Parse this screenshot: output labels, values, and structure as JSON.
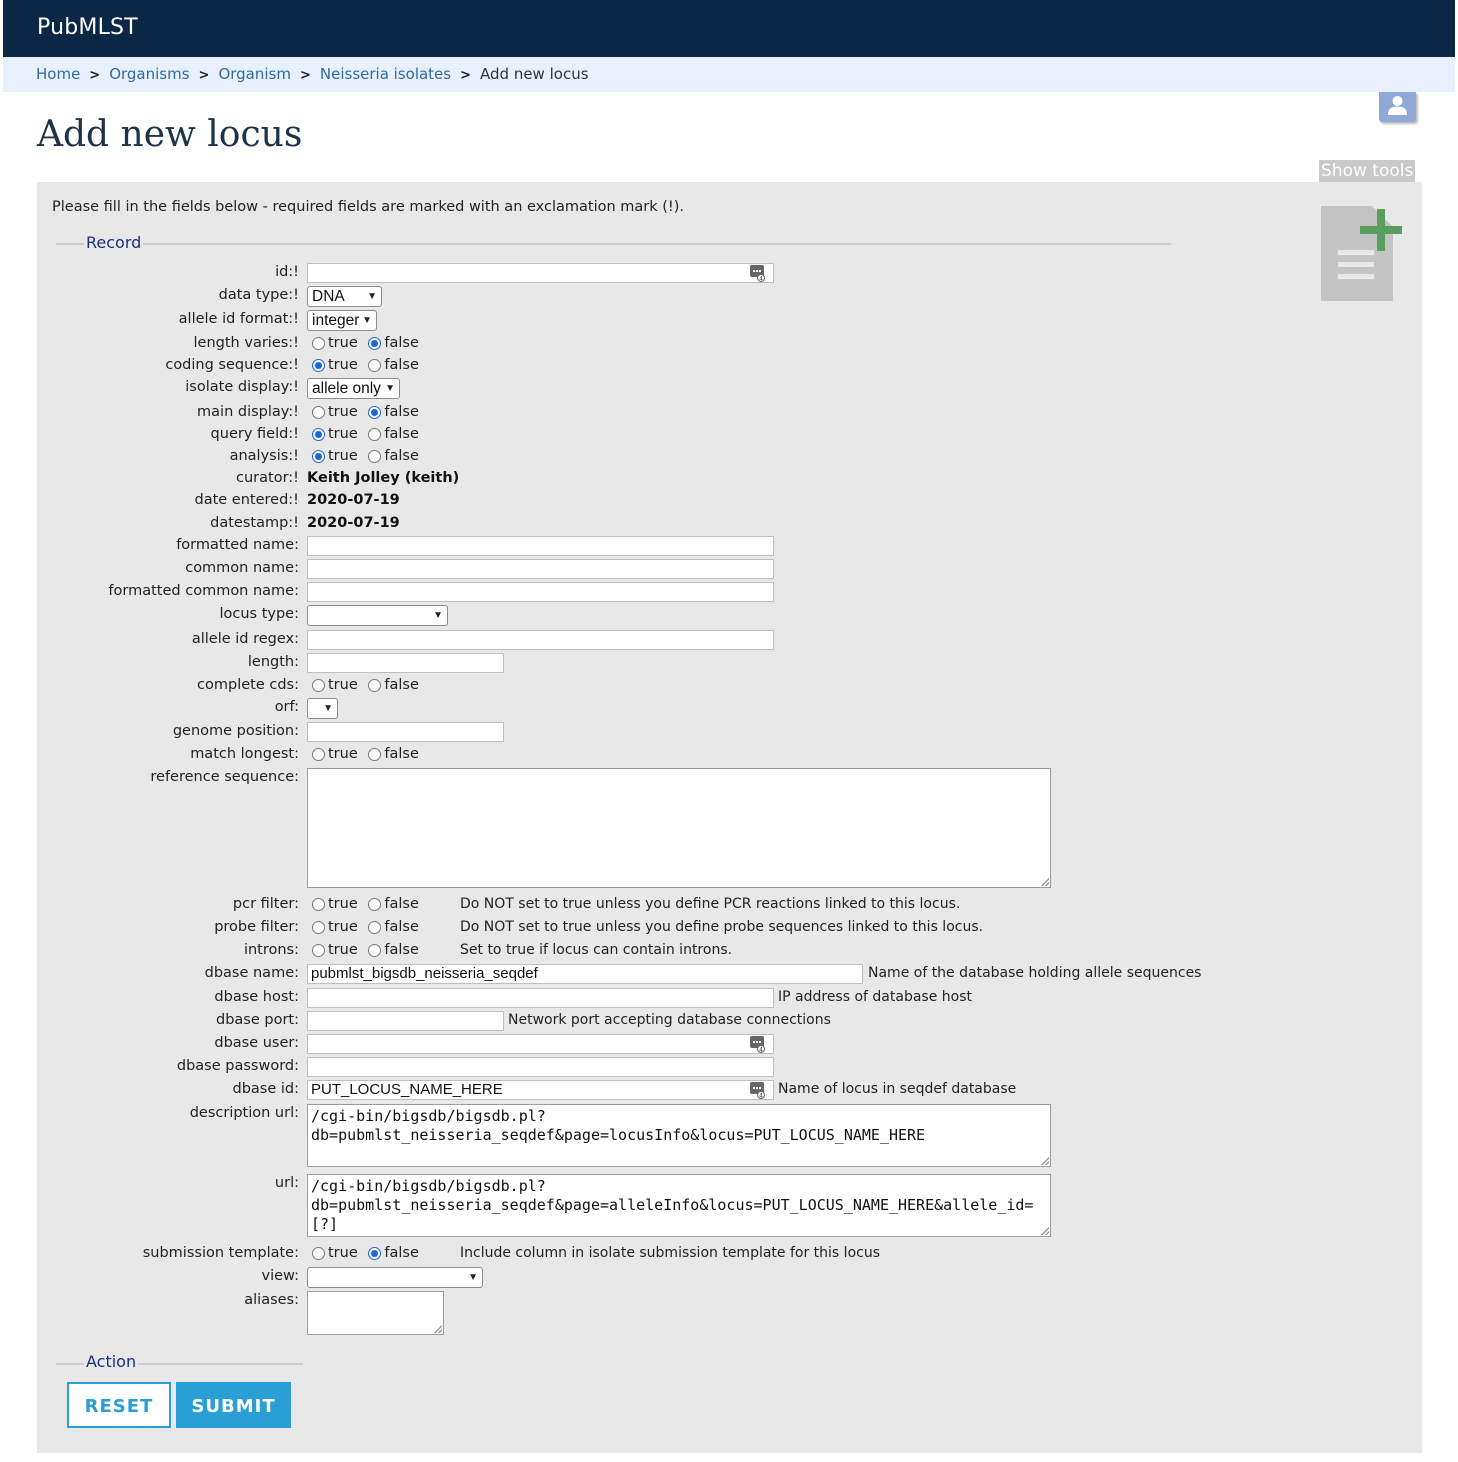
{
  "header": {
    "brand": "PubMLST"
  },
  "breadcrumb": {
    "items": [
      "Home",
      "Organisms",
      "Organism",
      "Neisseria isolates"
    ],
    "current": "Add new locus"
  },
  "page": {
    "title": "Add new locus",
    "show_tools": "Show tools"
  },
  "form": {
    "intro": "Please fill in the fields below - required fields are marked with an exclamation mark (!).",
    "record_legend": "Record",
    "action_legend": "Action",
    "radio_true": "true",
    "radio_false": "false",
    "fields": {
      "id": {
        "label": "id:!",
        "value": ""
      },
      "data_type": {
        "label": "data type:!",
        "value": "DNA"
      },
      "allele_id_format": {
        "label": "allele id format:!",
        "value": "integer"
      },
      "length_varies": {
        "label": "length varies:!",
        "value": "false"
      },
      "coding_sequence": {
        "label": "coding sequence:!",
        "value": "true"
      },
      "isolate_display": {
        "label": "isolate display:!",
        "value": "allele only"
      },
      "main_display": {
        "label": "main display:!",
        "value": "false"
      },
      "query_field": {
        "label": "query field:!",
        "value": "true"
      },
      "analysis": {
        "label": "analysis:!",
        "value": "true"
      },
      "curator": {
        "label": "curator:!",
        "value": "Keith Jolley (keith)"
      },
      "date_entered": {
        "label": "date entered:!",
        "value": "2020-07-19"
      },
      "datestamp": {
        "label": "datestamp:!",
        "value": "2020-07-19"
      },
      "formatted_name": {
        "label": "formatted name:",
        "value": ""
      },
      "common_name": {
        "label": "common name:",
        "value": ""
      },
      "formatted_common_name": {
        "label": "formatted common name:",
        "value": ""
      },
      "locus_type": {
        "label": "locus type:",
        "value": ""
      },
      "allele_id_regex": {
        "label": "allele id regex:",
        "value": ""
      },
      "length": {
        "label": "length:",
        "value": ""
      },
      "complete_cds": {
        "label": "complete cds:",
        "value": ""
      },
      "orf": {
        "label": "orf:",
        "value": ""
      },
      "genome_position": {
        "label": "genome position:",
        "value": ""
      },
      "match_longest": {
        "label": "match longest:",
        "value": ""
      },
      "reference_sequence": {
        "label": "reference sequence:",
        "value": ""
      },
      "pcr_filter": {
        "label": "pcr filter:",
        "value": "",
        "note": "Do NOT set to true unless you define PCR reactions linked to this locus."
      },
      "probe_filter": {
        "label": "probe filter:",
        "value": "",
        "note": "Do NOT set to true unless you define probe sequences linked to this locus."
      },
      "introns": {
        "label": "introns:",
        "value": "",
        "note": "Set to true if locus can contain introns."
      },
      "dbase_name": {
        "label": "dbase name:",
        "value": "pubmlst_bigsdb_neisseria_seqdef",
        "note": "Name of the database holding allele sequences"
      },
      "dbase_host": {
        "label": "dbase host:",
        "value": "",
        "note": "IP address of database host"
      },
      "dbase_port": {
        "label": "dbase port:",
        "value": "",
        "note": "Network port accepting database connections"
      },
      "dbase_user": {
        "label": "dbase user:",
        "value": ""
      },
      "dbase_password": {
        "label": "dbase password:",
        "value": ""
      },
      "dbase_id": {
        "label": "dbase id:",
        "value": "PUT_LOCUS_NAME_HERE",
        "note": "Name of locus in seqdef database"
      },
      "description_url": {
        "label": "description url:",
        "value": "/cgi-bin/bigsdb/bigsdb.pl?\ndb=pubmlst_neisseria_seqdef&page=locusInfo&locus=PUT_LOCUS_NAME_HERE"
      },
      "url": {
        "label": "url:",
        "value": "/cgi-bin/bigsdb/bigsdb.pl?\ndb=pubmlst_neisseria_seqdef&page=alleleInfo&locus=PUT_LOCUS_NAME_HERE&allele_id=[?]"
      },
      "submission_template": {
        "label": "submission template:",
        "value": "false",
        "note": "Include column in isolate submission template for this locus"
      },
      "view": {
        "label": "view:",
        "value": ""
      },
      "aliases": {
        "label": "aliases:",
        "value": ""
      }
    },
    "buttons": {
      "reset": "RESET",
      "submit": "SUBMIT"
    }
  },
  "icons": {
    "user": "user-icon",
    "add_document": "add-document-icon",
    "keyboard": "keyboard-icon",
    "dropdown": "chevron-down-icon"
  },
  "colors": {
    "header_bg": "#0b2746",
    "breadcrumb_bg": "#e8f0fb",
    "panel_bg": "#e8e8e8",
    "accent": "#2a9fd6",
    "legend": "#1b2f80"
  }
}
